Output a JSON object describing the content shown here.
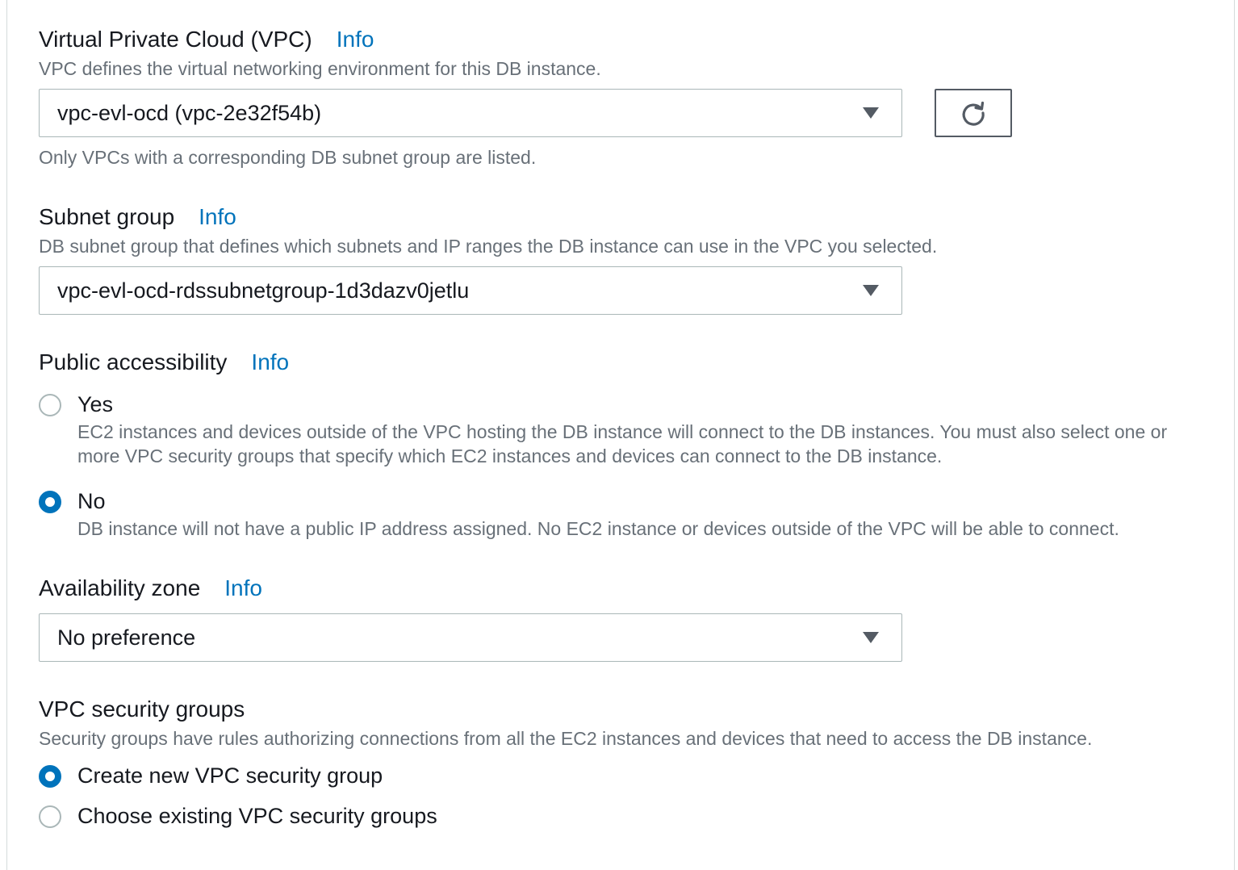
{
  "vpc": {
    "label": "Virtual Private Cloud (VPC)",
    "info": "Info",
    "description": "VPC defines the virtual networking environment for this DB instance.",
    "selected": "vpc-evl-ocd (vpc-2e32f54b)",
    "hint": "Only VPCs with a corresponding DB subnet group are listed."
  },
  "subnet": {
    "label": "Subnet group",
    "info": "Info",
    "description": "DB subnet group that defines which subnets and IP ranges the DB instance can use in the VPC you selected.",
    "selected": "vpc-evl-ocd-rdssubnetgroup-1d3dazv0jetlu"
  },
  "public_access": {
    "label": "Public accessibility",
    "info": "Info",
    "options": [
      {
        "label": "Yes",
        "description": "EC2 instances and devices outside of the VPC hosting the DB instance will connect to the DB instances. You must also select one or more VPC security groups that specify which EC2 instances and devices can connect to the DB instance.",
        "checked": false
      },
      {
        "label": "No",
        "description": "DB instance will not have a public IP address assigned. No EC2 instance or devices outside of the VPC will be able to connect.",
        "checked": true
      }
    ]
  },
  "availability_zone": {
    "label": "Availability zone",
    "info": "Info",
    "selected": "No preference"
  },
  "security_groups": {
    "label": "VPC security groups",
    "description": "Security groups have rules authorizing connections from all the EC2 instances and devices that need to access the DB instance.",
    "options": [
      {
        "label": "Create new VPC security group",
        "checked": true
      },
      {
        "label": "Choose existing VPC security groups",
        "checked": false
      }
    ]
  },
  "icons": {
    "refresh": "refresh-icon",
    "dropdown": "caret-down-icon"
  },
  "colors": {
    "link": "#0073bb",
    "radio_selected": "#0073bb",
    "text": "#16191f",
    "muted": "#687078",
    "border": "#aab7b8"
  }
}
